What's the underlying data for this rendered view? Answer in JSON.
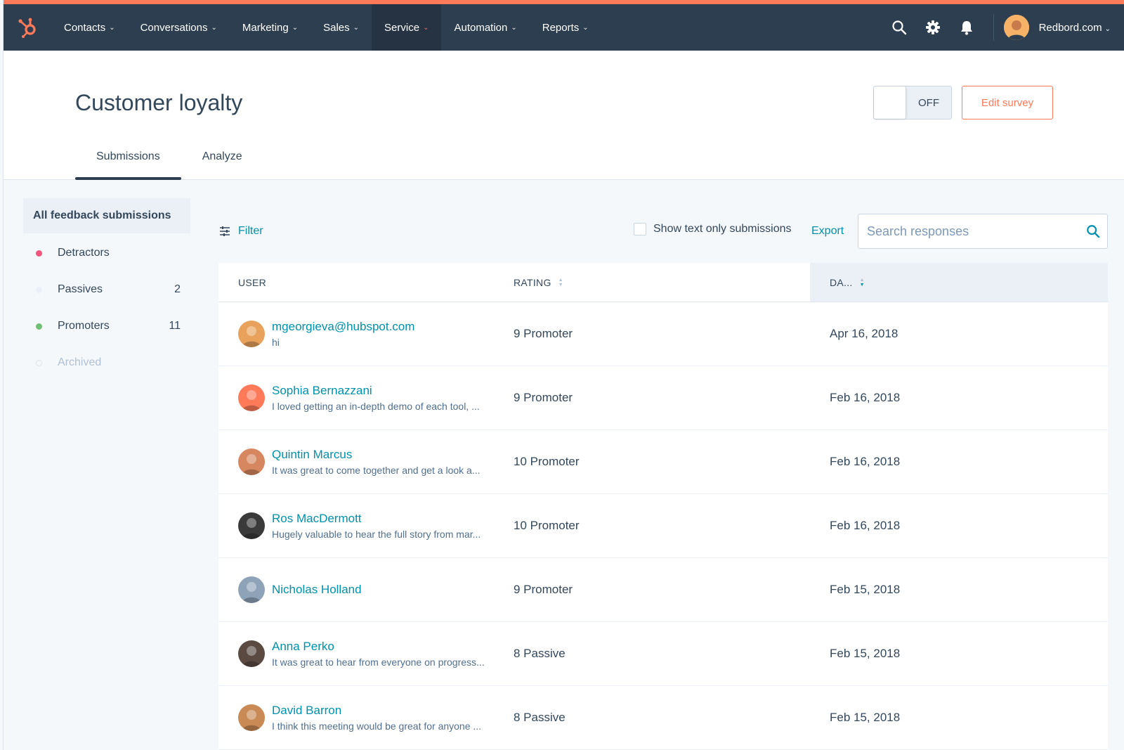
{
  "nav": {
    "items": [
      {
        "label": "Contacts",
        "active": false
      },
      {
        "label": "Conversations",
        "active": false
      },
      {
        "label": "Marketing",
        "active": false
      },
      {
        "label": "Sales",
        "active": false
      },
      {
        "label": "Service",
        "active": true
      },
      {
        "label": "Automation",
        "active": false
      },
      {
        "label": "Reports",
        "active": false
      }
    ],
    "account": "Redbord.com",
    "accent_color": "#ff7a59",
    "bg_color": "#2d3e50"
  },
  "header": {
    "title": "Customer loyalty",
    "toggle_state": "OFF",
    "edit_button": "Edit survey",
    "tabs": [
      {
        "label": "Submissions",
        "active": true
      },
      {
        "label": "Analyze",
        "active": false
      }
    ]
  },
  "sidebar": {
    "items": [
      {
        "label": "All feedback submissions",
        "count": "",
        "dot": "",
        "active": true
      },
      {
        "label": "Detractors",
        "count": "",
        "dot": "#f2547d",
        "active": false
      },
      {
        "label": "Passives",
        "count": "2",
        "dot": "#eaf0f6",
        "active": false
      },
      {
        "label": "Promoters",
        "count": "11",
        "dot": "#6fbf73",
        "active": false
      },
      {
        "label": "Archived",
        "count": "",
        "dot": "ring",
        "active": false
      }
    ]
  },
  "toolbar": {
    "filter_label": "Filter",
    "text_only_label": "Show text only submissions",
    "export_label": "Export",
    "search_placeholder": "Search responses"
  },
  "table": {
    "headers": {
      "user": "USER",
      "rating": "RATING",
      "date": "DA..."
    },
    "rows": [
      {
        "name": "mgeorgieva@hubspot.com",
        "comment": "hi",
        "rating": "9 Promoter",
        "date": "Apr 16, 2018",
        "avatar_color": "#e8a25b"
      },
      {
        "name": "Sophia Bernazzani",
        "comment": "I loved getting an in-depth demo of each tool, ...",
        "rating": "9 Promoter",
        "date": "Feb 16, 2018",
        "avatar_color": "#ff7a59"
      },
      {
        "name": "Quintin Marcus",
        "comment": "It was great to come together and get a look a...",
        "rating": "10 Promoter",
        "date": "Feb 16, 2018",
        "avatar_color": "#d7875f"
      },
      {
        "name": "Ros MacDermott",
        "comment": "Hugely valuable to hear the full story from mar...",
        "rating": "10 Promoter",
        "date": "Feb 16, 2018",
        "avatar_color": "#3a3a3a"
      },
      {
        "name": "Nicholas Holland",
        "comment": "",
        "rating": "9 Promoter",
        "date": "Feb 15, 2018",
        "avatar_color": "#8fa3b8"
      },
      {
        "name": "Anna Perko",
        "comment": "It was great to hear from everyone on progress...",
        "rating": "8 Passive",
        "date": "Feb 15, 2018",
        "avatar_color": "#5a4a42"
      },
      {
        "name": "David Barron",
        "comment": "I think this meeting would be great for anyone ...",
        "rating": "8 Passive",
        "date": "Feb 15, 2018",
        "avatar_color": "#c98a55"
      }
    ]
  }
}
